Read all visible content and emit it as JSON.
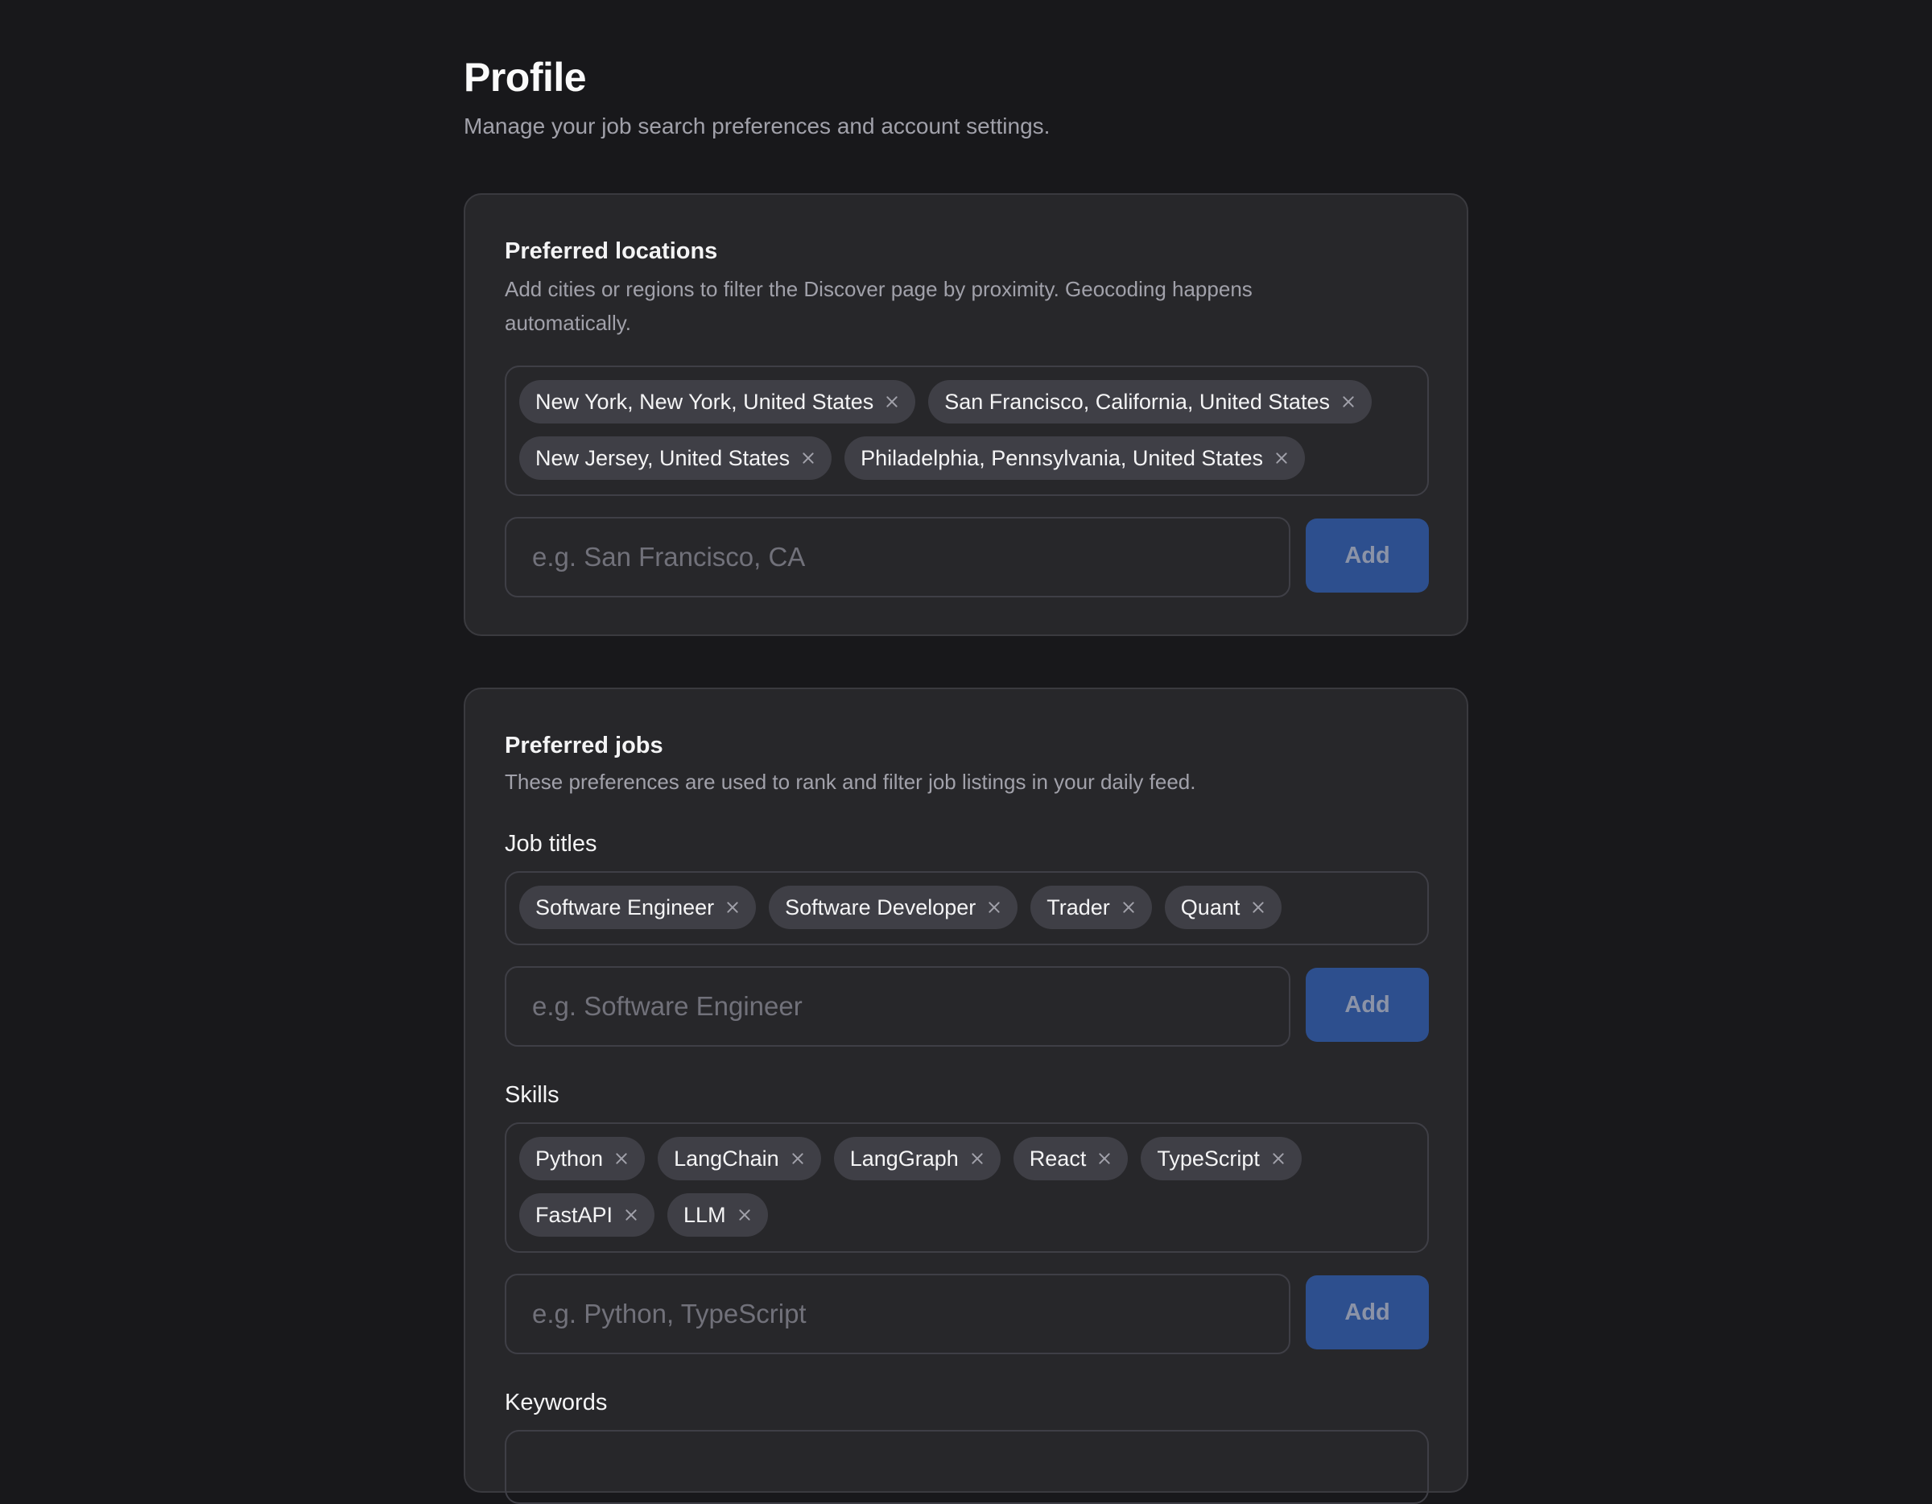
{
  "header": {
    "title": "Profile",
    "subtitle": "Manage your job search preferences and account settings."
  },
  "locations": {
    "title": "Preferred locations",
    "description": "Add cities or regions to filter the Discover page by proximity. Geocoding happens automatically.",
    "chips": [
      "New York, New York, United States",
      "San Francisco, California, United States",
      "New Jersey, United States",
      "Philadelphia, Pennsylvania, United States"
    ],
    "input_placeholder": "e.g. San Francisco, CA",
    "add_label": "Add"
  },
  "jobs": {
    "title": "Preferred jobs",
    "description": "These preferences are used to rank and filter job listings in your daily feed.",
    "job_titles": {
      "label": "Job titles",
      "chips": [
        "Software Engineer",
        "Software Developer",
        "Trader",
        "Quant"
      ],
      "input_placeholder": "e.g. Software Engineer",
      "add_label": "Add"
    },
    "skills": {
      "label": "Skills",
      "chips": [
        "Python",
        "LangChain",
        "LangGraph",
        "React",
        "TypeScript",
        "FastAPI",
        "LLM"
      ],
      "input_placeholder": "e.g. Python, TypeScript",
      "add_label": "Add"
    },
    "keywords": {
      "label": "Keywords"
    }
  },
  "colors": {
    "background": "#18181b",
    "card": "#27272a",
    "chip": "#3f3f46",
    "accent_button": "#2d4f8e"
  },
  "icons": {
    "chip_remove": "close-icon"
  }
}
